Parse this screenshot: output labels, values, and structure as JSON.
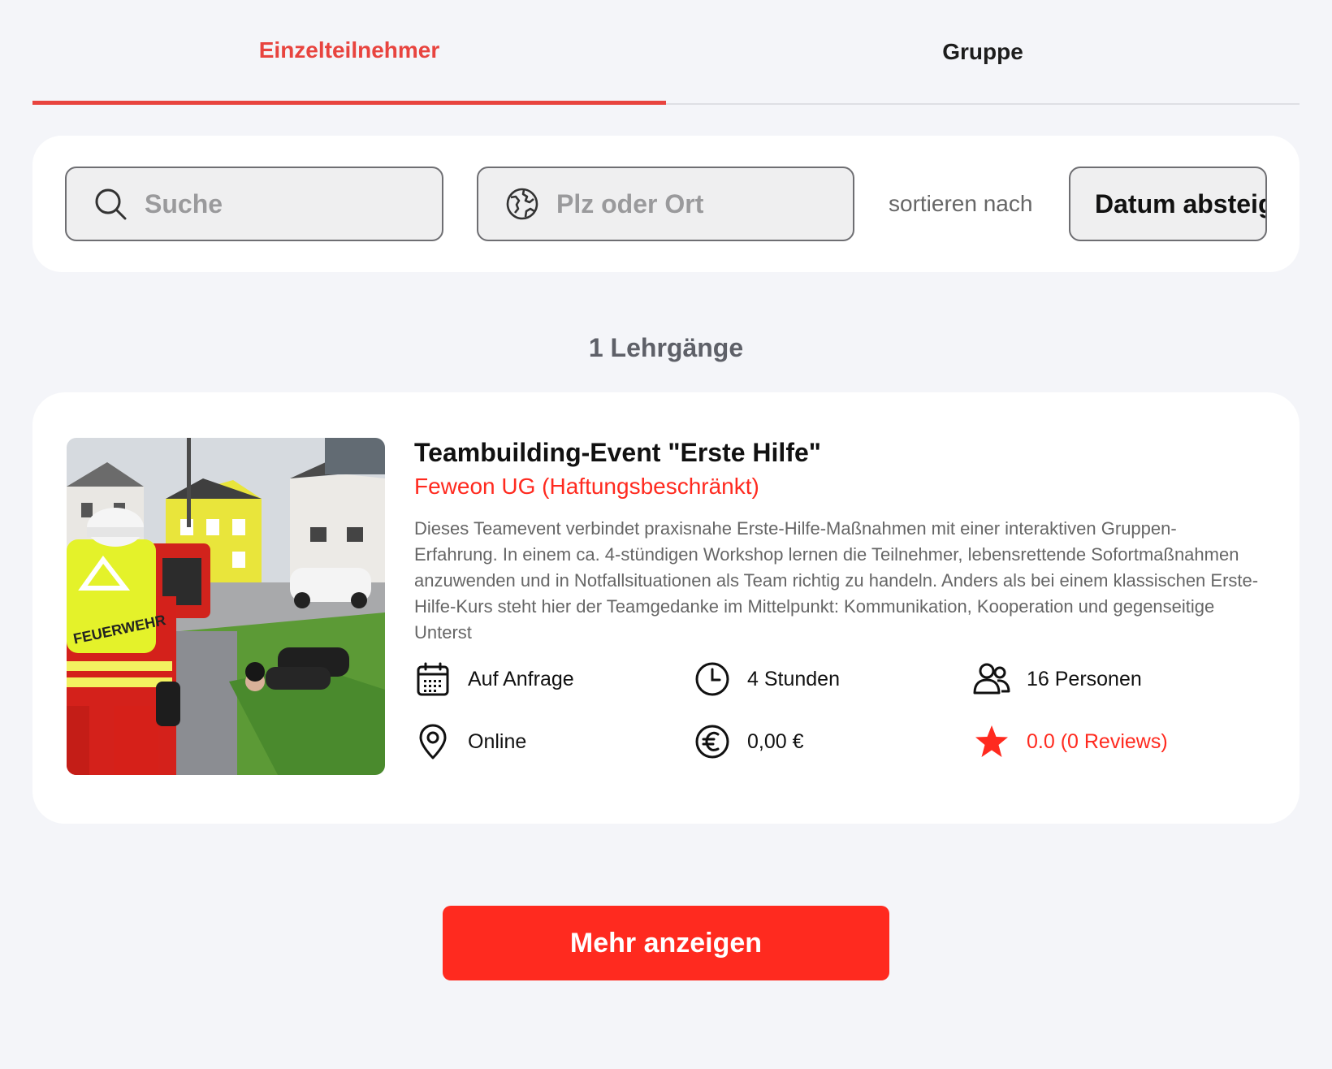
{
  "tabs": [
    {
      "label": "Einzelteilnehmer",
      "active": true
    },
    {
      "label": "Gruppe",
      "active": false
    }
  ],
  "filters": {
    "search_placeholder": "Suche",
    "place_placeholder": "Plz oder Ort",
    "sort_label": "sortieren nach",
    "sort_value": "Datum absteigend"
  },
  "results": {
    "count_text": "1 Lehrgänge"
  },
  "course": {
    "title": "Teambuilding-Event \"Erste Hilfe\"",
    "provider": "Feweon UG (Haftungsbeschränkt)",
    "description": "Dieses Teamevent verbindet praxisnahe Erste-Hilfe-Maßnahmen mit einer interaktiven Gruppen-Erfahrung. In einem ca. 4-stündigen Workshop lernen die Teilnehmer, lebensrettende Sofortmaßnahmen anzuwenden und in Notfallsituationen als Team richtig zu handeln. Anders als bei einem klassischen Erste-Hilfe-Kurs steht hier der Teamgedanke im Mittelpunkt: Kommunikation, Kooperation und gegenseitige Unterst",
    "image_vest_text": "FEUERWEHR",
    "date": "Auf Anfrage",
    "duration": "4 Stunden",
    "persons": "16 Personen",
    "location": "Online",
    "price": "0,00 €",
    "rating": "0.0 (0 Reviews)"
  },
  "colors": {
    "accent": "#ff2a1f",
    "tab_accent": "#e8443f",
    "background": "#f4f5f9"
  },
  "icons": [
    "search-icon",
    "globe-icon",
    "calendar-icon",
    "clock-icon",
    "people-icon",
    "location-pin-icon",
    "euro-icon",
    "star-icon"
  ],
  "more_button": {
    "label": "Mehr anzeigen"
  }
}
